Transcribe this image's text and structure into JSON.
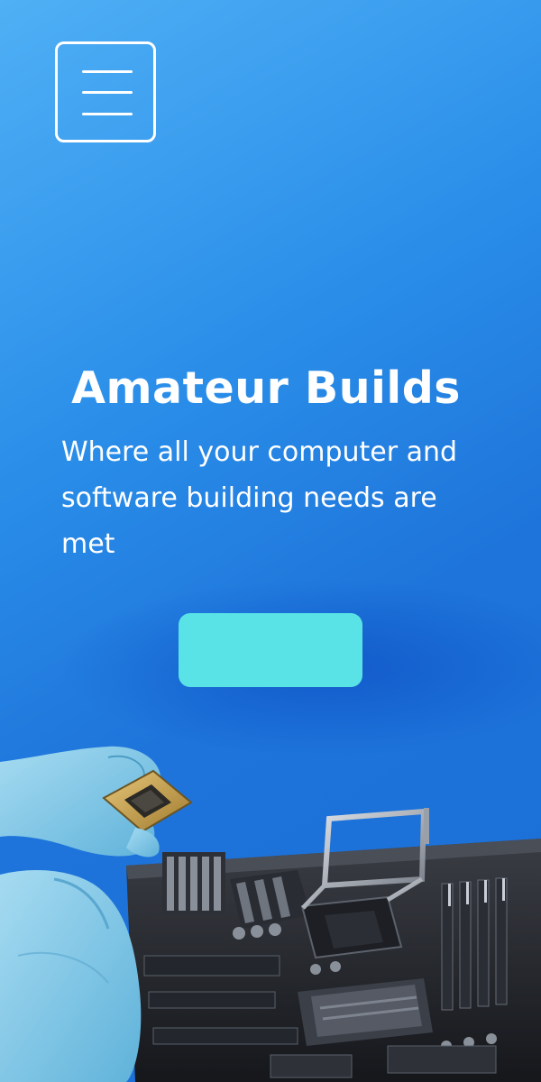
{
  "header": {
    "menu_icon": "hamburger-menu-icon"
  },
  "hero": {
    "title": "Amateur Builds",
    "subtitle": "Where all your computer and software building needs are met",
    "cta_label": ""
  },
  "image": {
    "subject": "gloved-hand-holding-cpu-over-motherboard"
  },
  "colors": {
    "background_top": "#4fb0f5",
    "background_bottom": "#1b6fd8",
    "text": "#ffffff",
    "cta": "#5ae3e6",
    "glove": "#7fc6e6"
  }
}
